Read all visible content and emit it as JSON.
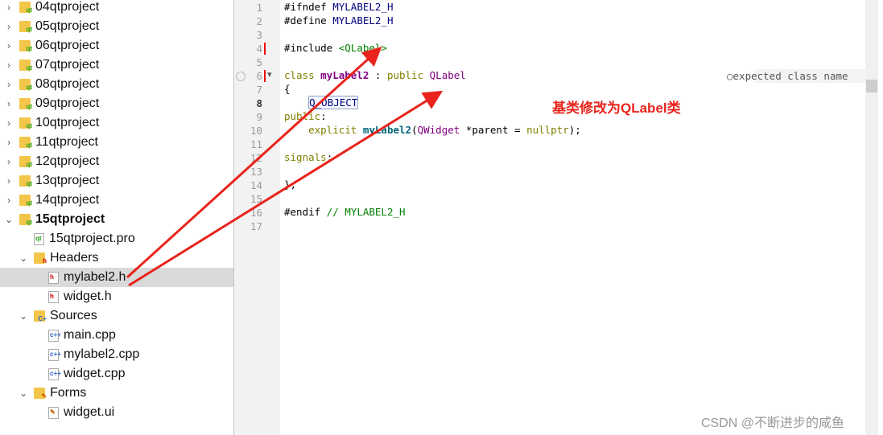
{
  "sidebar": {
    "items": [
      {
        "label": "04qtproject",
        "level": 0,
        "type": "project",
        "expanded": false
      },
      {
        "label": "05qtproject",
        "level": 0,
        "type": "project",
        "expanded": false
      },
      {
        "label": "06qtproject",
        "level": 0,
        "type": "project",
        "expanded": false
      },
      {
        "label": "07qtproject",
        "level": 0,
        "type": "project",
        "expanded": false
      },
      {
        "label": "08qtproject",
        "level": 0,
        "type": "project",
        "expanded": false
      },
      {
        "label": "09qtproject",
        "level": 0,
        "type": "project",
        "expanded": false
      },
      {
        "label": "10qtproject",
        "level": 0,
        "type": "project",
        "expanded": false
      },
      {
        "label": "11qtproject",
        "level": 0,
        "type": "project",
        "expanded": false
      },
      {
        "label": "12qtproject",
        "level": 0,
        "type": "project",
        "expanded": false
      },
      {
        "label": "13qtproject",
        "level": 0,
        "type": "project",
        "expanded": false
      },
      {
        "label": "14qtproject",
        "level": 0,
        "type": "project",
        "expanded": false
      },
      {
        "label": "15qtproject",
        "level": 0,
        "type": "project",
        "expanded": true,
        "bold": true
      },
      {
        "label": "15qtproject.pro",
        "level": 1,
        "type": "pro"
      },
      {
        "label": "Headers",
        "level": 1,
        "type": "folder-h",
        "expanded": true
      },
      {
        "label": "mylabel2.h",
        "level": 2,
        "type": "h",
        "selected": true
      },
      {
        "label": "widget.h",
        "level": 2,
        "type": "h"
      },
      {
        "label": "Sources",
        "level": 1,
        "type": "folder-cpp",
        "expanded": true
      },
      {
        "label": "main.cpp",
        "level": 2,
        "type": "cpp"
      },
      {
        "label": "mylabel2.cpp",
        "level": 2,
        "type": "cpp"
      },
      {
        "label": "widget.cpp",
        "level": 2,
        "type": "cpp"
      },
      {
        "label": "Forms",
        "level": 1,
        "type": "folder-ui",
        "expanded": true
      },
      {
        "label": "widget.ui",
        "level": 2,
        "type": "ui"
      }
    ]
  },
  "editor": {
    "lines": [
      [
        [
          "#ifndef ",
          "#000"
        ],
        [
          "MYLABEL2_H",
          "#000080"
        ]
      ],
      [
        [
          "#define ",
          "#000"
        ],
        [
          "MYLABEL2_H",
          "#000080"
        ]
      ],
      [],
      [
        [
          "#include ",
          "#000"
        ],
        [
          "<QLabel>",
          "#008000"
        ]
      ],
      [],
      [
        [
          "class ",
          "#808000"
        ],
        [
          "myLabel2",
          "#800080",
          true
        ],
        [
          " : ",
          "#000"
        ],
        [
          "public ",
          "#808000"
        ],
        [
          "QLabel",
          "#800080"
        ]
      ],
      [
        [
          "{",
          "#000"
        ]
      ],
      [
        [
          "    ",
          "#000"
        ],
        [
          "Q_OBJECT",
          "#000080",
          "box"
        ]
      ],
      [
        [
          "public",
          "#808000"
        ],
        [
          ":",
          "#000"
        ]
      ],
      [
        [
          "    explicit ",
          "#808000"
        ],
        [
          "myLabel2",
          "#00677c",
          true
        ],
        [
          "(",
          "#000"
        ],
        [
          "QWidget",
          "#800080"
        ],
        [
          " *parent = ",
          "#000"
        ],
        [
          "nullptr",
          "#808000"
        ],
        [
          ");",
          "#000"
        ]
      ],
      [],
      [
        [
          "signals",
          "#808000"
        ],
        [
          ":",
          "#000"
        ]
      ],
      [],
      [
        [
          "};",
          "#000"
        ]
      ],
      [],
      [
        [
          "#endif ",
          "#000"
        ],
        [
          "// MYLABEL2_H",
          "#008000"
        ]
      ],
      []
    ],
    "modified_lines": [
      4,
      6
    ],
    "current_line": 6,
    "warning": "expected class name"
  },
  "annotation": "基类修改为QLabel类",
  "watermark": "CSDN @不断进步的咸鱼",
  "colors": {
    "arrow": "#e8241c"
  }
}
